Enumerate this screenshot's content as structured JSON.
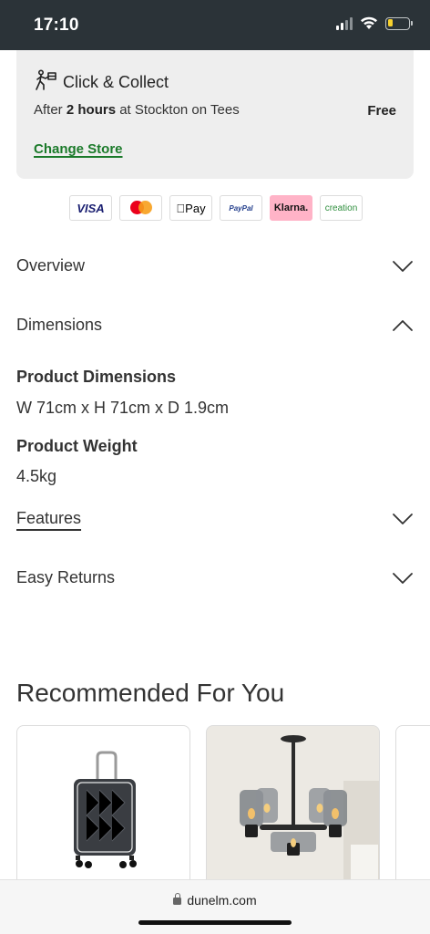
{
  "status_bar": {
    "time": "17:10"
  },
  "collect": {
    "title": "Click & Collect",
    "line_prefix": "After ",
    "line_bold": "2 hours",
    "line_suffix": " at Stockton on Tees",
    "price": "Free",
    "change_store": "Change Store"
  },
  "payments": [
    {
      "name": "visa",
      "label": "VISA"
    },
    {
      "name": "mastercard",
      "label": ""
    },
    {
      "name": "applepay",
      "label": "Pay"
    },
    {
      "name": "paypal",
      "label": "PayPal"
    },
    {
      "name": "klarna",
      "label": "Klarna."
    },
    {
      "name": "creation",
      "label": "creation"
    }
  ],
  "accordion": {
    "overview": "Overview",
    "dimensions": "Dimensions",
    "features": "Features",
    "easy_returns": "Easy Returns"
  },
  "dimensions": {
    "product_dimensions_label": "Product Dimensions",
    "product_dimensions_value": "W 71cm x H 71cm x D 1.9cm",
    "product_weight_label": "Product Weight",
    "product_weight_value": "4.5kg"
  },
  "recommended": {
    "title": "Recommended For You"
  },
  "browser": {
    "url": "dunelm.com"
  }
}
